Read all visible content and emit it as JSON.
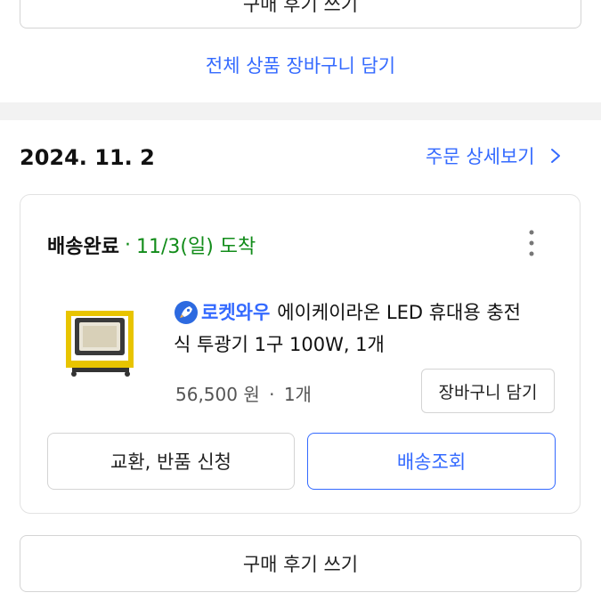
{
  "top_section": {
    "review_button_label": "구매 후기 쓰기",
    "add_all_to_cart_label": "전체 상품 장바구니 담기"
  },
  "order": {
    "date": "2024. 11. 2",
    "detail_link_label": "주문 상세보기",
    "status": "배송완료",
    "separator": "·",
    "arrival": "11/3(일) 도착",
    "badge_label": "로켓와우",
    "product_title_line1": "에이케이라온 LED 휴대용 충전",
    "product_title_line2": "식 투광기 1구 100W, 1개",
    "price": "56,500 원",
    "quantity": "1개",
    "add_to_cart_label": "장바구니 담기",
    "exchange_return_label": "교환, 반품 신청",
    "track_delivery_label": "배송조회",
    "review_button_label": "구매 후기 쓰기"
  },
  "colors": {
    "accent_blue": "#346aff",
    "status_green": "#128c1a",
    "divider_gray": "#f2f2f2"
  },
  "icons": {
    "chevron": "chevron-right-icon",
    "more": "more-vertical-icon",
    "badge": "rocket-icon"
  }
}
